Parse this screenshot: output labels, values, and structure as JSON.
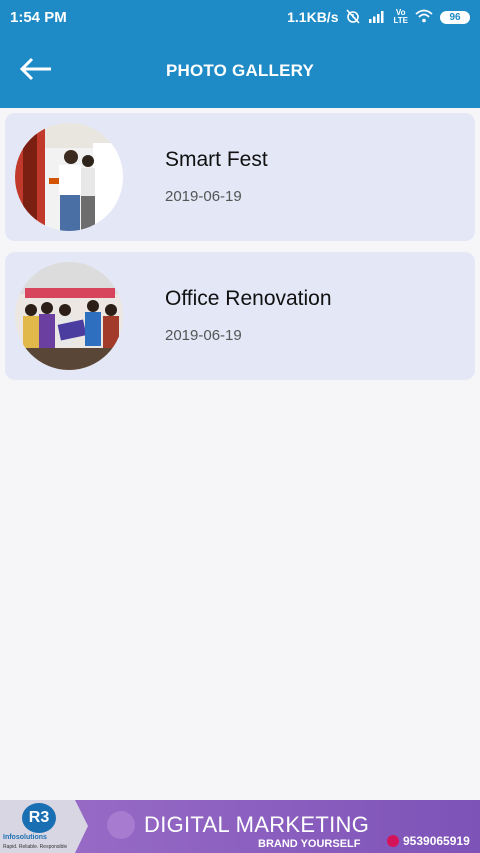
{
  "status_bar": {
    "time": "1:54 PM",
    "network_speed": "1.1KB/s",
    "volte_top": "Vo",
    "volte_bottom": "LTE",
    "battery": "96",
    "icons": [
      "alarm-off-icon",
      "signal-icon",
      "volte-icon",
      "wifi-icon",
      "battery-icon"
    ]
  },
  "app_bar": {
    "title": "PHOTO GALLERY",
    "back_icon": "arrow-left-icon",
    "background": "#1f8bc6"
  },
  "gallery": {
    "items": [
      {
        "title": "Smart Fest",
        "date": "2019-06-19"
      },
      {
        "title": "Office Renovation",
        "date": "2019-06-19"
      }
    ],
    "card_color": "#e3e7f6"
  },
  "ad_banner": {
    "logo_text": "R3",
    "brand_text": "Infosolutions",
    "tagline": "Rapid. Reliable. Responsible",
    "headline": "DIGITAL MARKETING",
    "subline": "BRAND YOURSELF",
    "phone": "9539065919",
    "accent": "#9b6ec8"
  }
}
